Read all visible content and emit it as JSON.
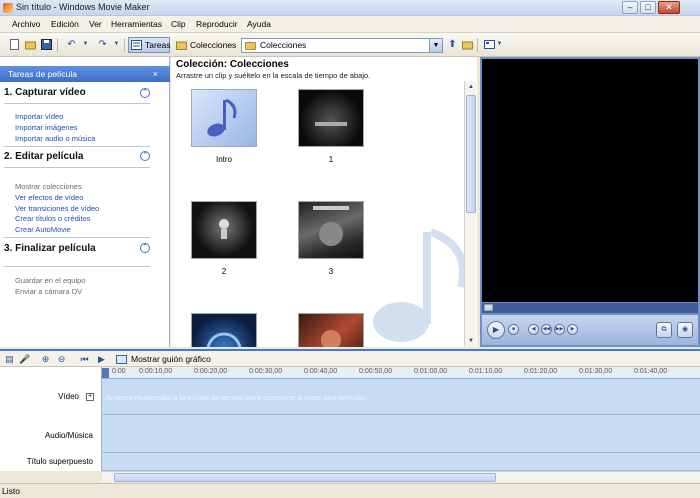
{
  "window": {
    "title": "Sin título - Windows Movie Maker",
    "minimize": "–",
    "maximize": "□",
    "close": "✕"
  },
  "menu": [
    "Archivo",
    "Edición",
    "Ver",
    "Herramientas",
    "Clip",
    "Reproducir",
    "Ayuda"
  ],
  "toolbar": {
    "tasks_label": "Tareas",
    "collections_label": "Colecciones",
    "collection_select": "Colecciones"
  },
  "task_pane": {
    "header": "Tareas de película",
    "close": "×",
    "sections": [
      {
        "title": "1. Capturar vídeo",
        "links": [
          "Importar vídeo",
          "Importar imágenes",
          "Importar audio o música"
        ]
      },
      {
        "title": "2. Editar película",
        "links": [
          "Mostrar colecciones",
          "Ver efectos de vídeo",
          "Ver transiciones de vídeo",
          "Crear títulos o créditos",
          "Crear AutoMovie"
        ]
      },
      {
        "title": "3. Finalizar película",
        "links": [
          "Guardar en el equipo",
          "Enviar a cámara DV"
        ]
      }
    ],
    "collapse_glyph": "⌃"
  },
  "collection": {
    "title": "Colección: Colecciones",
    "subtitle": "Arrastre un clip y suéltelo en la escala de tiempo de abajo.",
    "clips": [
      {
        "label": "Intro",
        "type": "music-note"
      },
      {
        "label": "1",
        "type": "dark-logo"
      },
      {
        "label": "2",
        "type": "dark-figure"
      },
      {
        "label": "3",
        "type": "game-art"
      },
      {
        "label": "",
        "type": "blue-emblem"
      },
      {
        "label": "",
        "type": "game-art-red"
      }
    ]
  },
  "timeline": {
    "show_storyboard": "Mostrar guión gráfico",
    "ruler_ticks": [
      "0:00",
      "0:00:10,00",
      "0:00:20,00",
      "0:00:30,00",
      "0:00:40,00",
      "0:00:50,00",
      "0:01:00,00",
      "0:01:10,00",
      "0:01:20,00",
      "0:01:30,00",
      "0:01:40,00"
    ],
    "tracks": [
      {
        "label": "Vídeo",
        "hint": "Arrastre multimedia a la escala de tiempo para comenzar a crear una película."
      },
      {
        "label": "Audio/Música",
        "hint": ""
      },
      {
        "label": "Título superpuesto",
        "hint": ""
      }
    ],
    "expand_glyph": "+"
  },
  "status": "Listo",
  "colors": {
    "accent": "#3f79d3",
    "track": "#c5dcf2",
    "link": "#1f4fb2",
    "task_header": "#3c6ec8"
  }
}
